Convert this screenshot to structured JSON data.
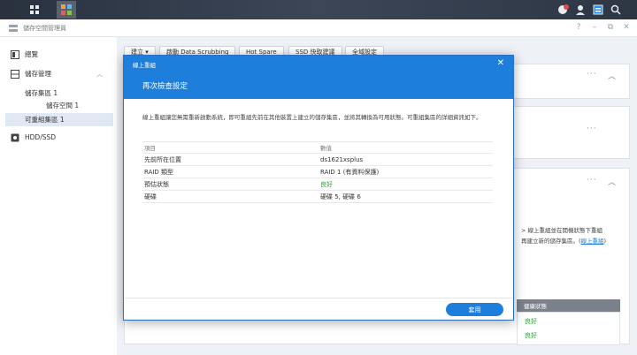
{
  "window": {
    "title": "儲存空間管理員"
  },
  "toolbar": {
    "create": "建立 ▾",
    "scrubbing": "啟動 Data Scrubbing",
    "hot_spare": "Hot Spare",
    "ssd_cache": "SSD 快取建議",
    "global": "全域設定"
  },
  "sidebar": {
    "items": [
      {
        "label": "總覽"
      },
      {
        "label": "儲存管理"
      },
      {
        "label": "儲存集區 1"
      },
      {
        "label": "儲存空間 1"
      },
      {
        "label": "可重組集區 1"
      },
      {
        "label": "HDD/SSD"
      }
    ]
  },
  "background_panel": {
    "text_line1": "> 線上重組並在開機狀態下重組",
    "text_line2": "再建立新的儲存集區。(",
    "link": "線上重組",
    "text_tail": ")",
    "col_health": "健康狀態",
    "row1_status": "良好",
    "row2_status": "良好"
  },
  "dialog": {
    "wizard_title": "線上重組",
    "step_title": "再次檢查設定",
    "description": "線上重組讓您無需重新啟動系統，即可重組先前在其他裝置上建立的儲存集區，並將其轉換為可用狀態。可重組集區的詳細資訊如下。",
    "table": {
      "headers": [
        "項目",
        "數值"
      ],
      "rows": [
        {
          "item": "先前所在位置",
          "value": "ds1621xsplus"
        },
        {
          "item": "RAID 類型",
          "value": "RAID 1 (有資料保護)"
        },
        {
          "item": "預估狀態",
          "value": "良好"
        },
        {
          "item": "硬碟",
          "value": "硬碟 5, 硬碟 6"
        }
      ]
    },
    "apply_label": "套用"
  },
  "colors": {
    "accent": "#1d7fdb",
    "ok": "#2aa137"
  }
}
